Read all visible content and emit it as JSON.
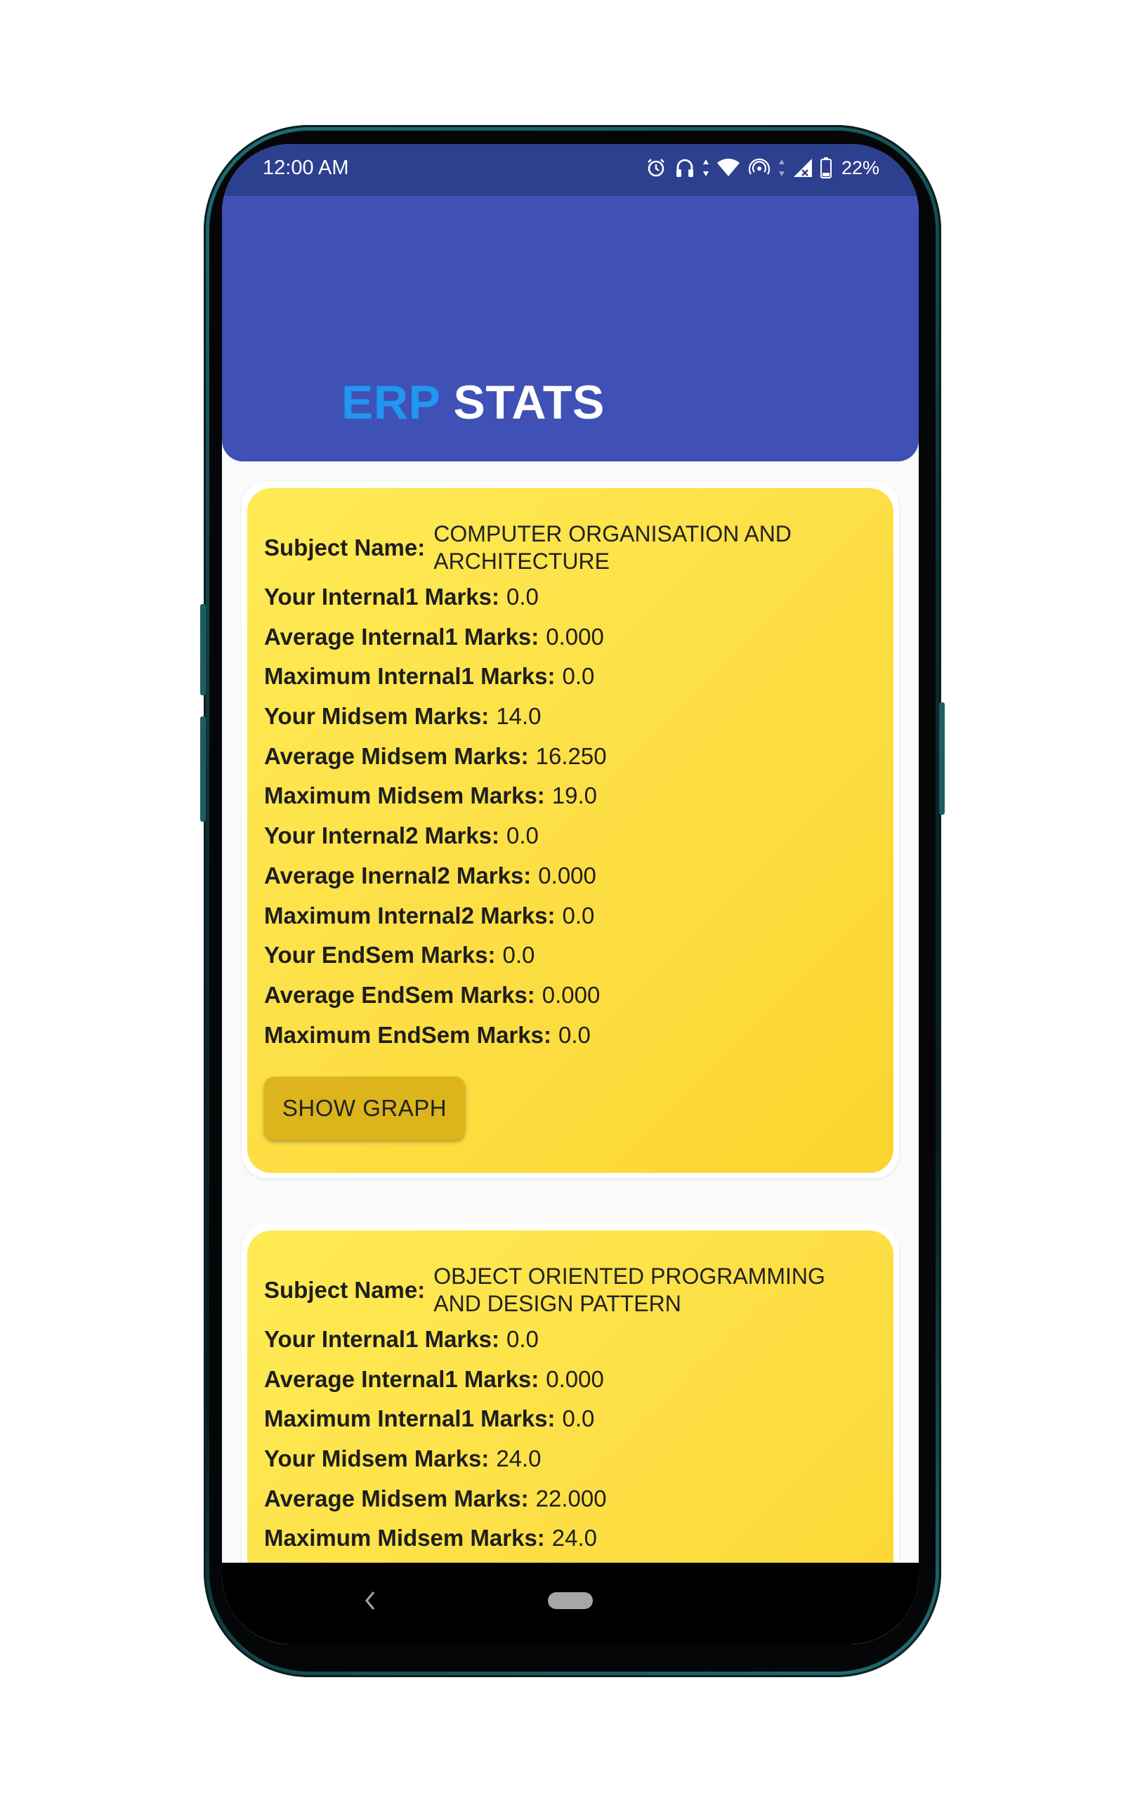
{
  "status_bar": {
    "time": "12:00 AM",
    "battery": "22%",
    "icons": [
      "alarm-icon",
      "headset-icon",
      "wifi-icon",
      "hotspot-icon",
      "signal-icon",
      "battery-icon"
    ]
  },
  "header": {
    "title_part1": "ERP",
    "title_part2": "STATS",
    "colors": {
      "background": "#3f51b5",
      "accent": "#2196f3"
    }
  },
  "cards": [
    {
      "subject_label": "Subject Name:",
      "subject_name": "COMPUTER ORGANISATION AND ARCHITECTURE",
      "rows": [
        {
          "label": "Your Internal1 Marks:",
          "value": "0.0"
        },
        {
          "label": "Average Internal1  Marks:",
          "value": "0.000"
        },
        {
          "label": "Maximum Internal1 Marks:",
          "value": "0.0"
        },
        {
          "label": "Your Midsem Marks:",
          "value": "14.0"
        },
        {
          "label": "Average Midsem Marks:",
          "value": "16.250"
        },
        {
          "label": "Maximum Midsem Marks:",
          "value": "19.0"
        },
        {
          "label": "Your Internal2 Marks:",
          "value": "0.0"
        },
        {
          "label": "Average Inernal2 Marks:",
          "value": "0.000"
        },
        {
          "label": "Maximum Internal2 Marks:",
          "value": "0.0"
        },
        {
          "label": "Your EndSem Marks:",
          "value": "0.0"
        },
        {
          "label": "Average EndSem Marks:",
          "value": "0.000"
        },
        {
          "label": "Maximum EndSem Marks:",
          "value": "0.0"
        }
      ],
      "button_label": "SHOW GRAPH"
    },
    {
      "subject_label": "Subject Name:",
      "subject_name": "OBJECT ORIENTED PROGRAMMING AND DESIGN PATTERN",
      "rows": [
        {
          "label": "Your Internal1 Marks:",
          "value": "0.0"
        },
        {
          "label": "Average Internal1  Marks:",
          "value": "0.000"
        },
        {
          "label": "Maximum Internal1 Marks:",
          "value": "0.0"
        },
        {
          "label": "Your Midsem Marks:",
          "value": "24.0"
        },
        {
          "label": "Average Midsem Marks:",
          "value": "22.000"
        },
        {
          "label": "Maximum Midsem Marks:",
          "value": "24.0"
        }
      ]
    }
  ],
  "navigation": {
    "back_icon": "chevron-left-icon",
    "home_icon": "home-pill-icon"
  },
  "colors": {
    "card": "#fde047",
    "button": "#dcb41c",
    "status_bar": "#2d3f8f"
  }
}
